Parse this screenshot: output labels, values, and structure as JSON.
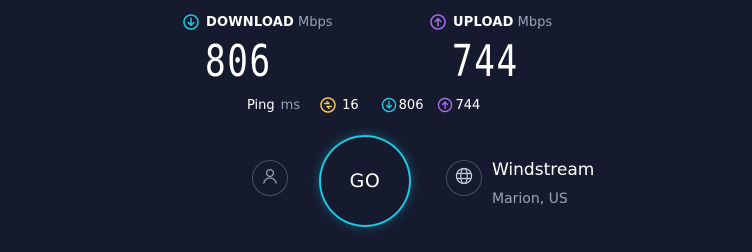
{
  "download": {
    "title": "DOWNLOAD",
    "unit": "Mbps",
    "value": "806",
    "icon": "download-arrow-icon",
    "color": "#1ec8df"
  },
  "upload": {
    "title": "UPLOAD",
    "unit": "Mbps",
    "value": "744",
    "icon": "upload-arrow-icon",
    "color": "#a86de6"
  },
  "ping": {
    "label": "Ping",
    "unit": "ms",
    "jitter_value": "16",
    "jitter_icon_color": "#f2c94c",
    "download_value": "806",
    "upload_value": "744"
  },
  "go": {
    "label": "GO",
    "ring_color": "#1ec8df"
  },
  "server": {
    "name": "Windstream",
    "location": "Marion, US"
  }
}
